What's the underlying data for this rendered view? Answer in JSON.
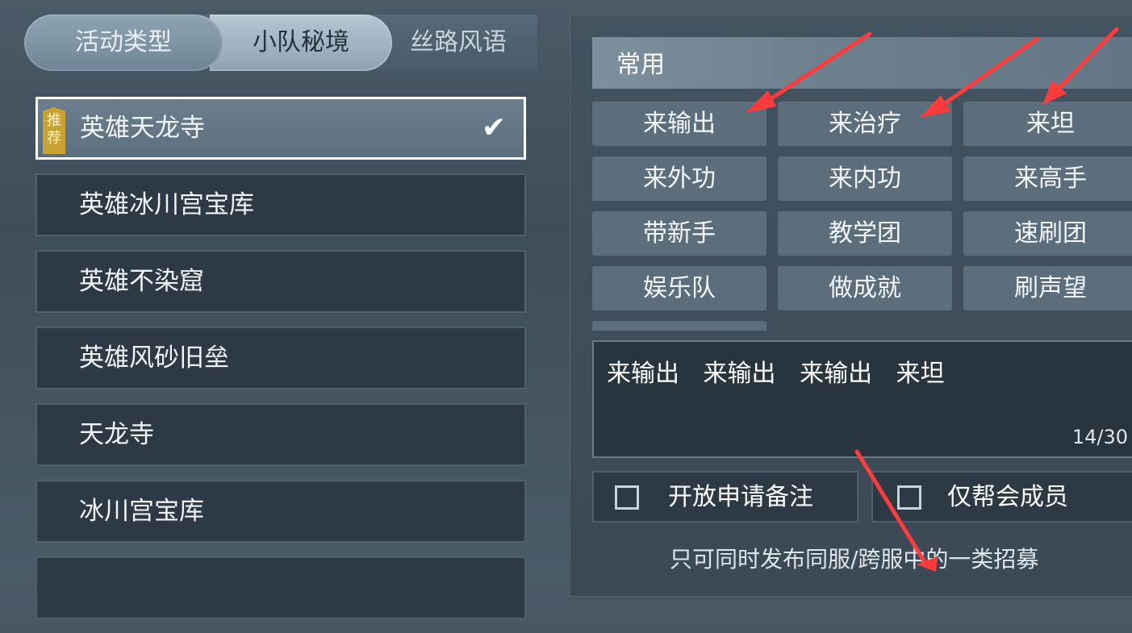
{
  "tabs": [
    {
      "label": "活动类型"
    },
    {
      "label": "小队秘境"
    },
    {
      "label": "丝路风语"
    }
  ],
  "dungeon_list": {
    "badge": "推荐",
    "items": [
      {
        "label": "英雄天龙寺",
        "selected": true
      },
      {
        "label": "英雄冰川宫宝库"
      },
      {
        "label": "英雄不染窟"
      },
      {
        "label": "英雄风砂旧垒"
      },
      {
        "label": "天龙寺"
      },
      {
        "label": "冰川宫宝库"
      }
    ]
  },
  "common": {
    "header": "常用",
    "chips": [
      "来输出",
      "来治疗",
      "来坦",
      "来外功",
      "来内功",
      "来高手",
      "带新手",
      "教学团",
      "速刷团",
      "娱乐队",
      "做成就",
      "刷声望"
    ]
  },
  "note": {
    "text": "来输出 来输出 来输出 来坦",
    "count": "14/30"
  },
  "options": {
    "open_apply_note": "开放申请备注",
    "guild_only": "仅帮会成员"
  },
  "footer": "只可同时发布同服/跨服中的一类招募",
  "colors": {
    "arrow": "#ff3b3b",
    "badge": "#c9a234"
  }
}
